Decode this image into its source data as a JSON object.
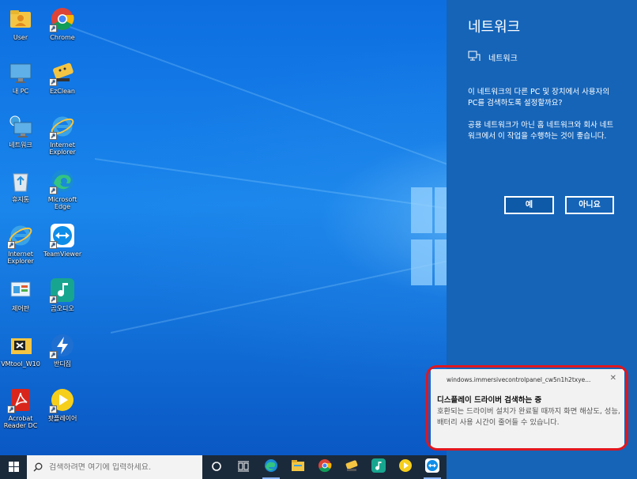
{
  "desktop": {
    "icons": [
      {
        "label": "User",
        "icon": "folder-user-icon"
      },
      {
        "label": "Chrome",
        "icon": "chrome-icon"
      },
      {
        "label": "내 PC",
        "icon": "monitor-icon"
      },
      {
        "label": "EzClean",
        "icon": "ezclean-icon"
      },
      {
        "label": "네트워크",
        "icon": "network-icon"
      },
      {
        "label": "Internet Explorer",
        "icon": "ie-icon"
      },
      {
        "label": "휴지통",
        "icon": "recycle-bin-icon"
      },
      {
        "label": "Microsoft Edge",
        "icon": "edge-icon"
      },
      {
        "label": "Internet Explorer",
        "icon": "ie-icon"
      },
      {
        "label": "TeamViewer",
        "icon": "teamviewer-icon"
      },
      {
        "label": "제어판",
        "icon": "control-panel-icon"
      },
      {
        "label": "곰오디오",
        "icon": "gom-audio-icon"
      },
      {
        "label": "VMtool_W10",
        "icon": "vmtool-icon"
      },
      {
        "label": "반디집",
        "icon": "bandizip-icon"
      },
      {
        "label": "Acrobat Reader DC",
        "icon": "acrobat-icon"
      },
      {
        "label": "팟플레이어",
        "icon": "potplayer-icon"
      }
    ]
  },
  "network_panel": {
    "title": "네트워크",
    "network_name": "네트워크",
    "question": "이 네트워크의 다른 PC 및 장치에서 사용자의 PC를 검색하도록 설정할까요?",
    "advice": "공용 네트워크가 아닌 홈 네트워크와 회사 네트워크에서 이 작업을 수행하는 것이 좋습니다.",
    "yes_label": "예",
    "no_label": "아니요"
  },
  "toast": {
    "app": "windows.immersivecontrolpanel_cw5n1h2txye...",
    "close": "✕",
    "title": "디스플레이 드라이버 검색하는 중",
    "body": "호환되는 드라이버 설치가 완료될 때까지 화면 해상도, 성능, 배터리 사용 시간이 줄어들 수 있습니다."
  },
  "taskbar": {
    "search_placeholder": "검색하려면 여기에 입력하세요.",
    "items": [
      "cortana-icon",
      "task-view-icon",
      "edge-icon",
      "file-explorer-icon",
      "chrome-icon",
      "ezclean-icon",
      "gom-audio-icon",
      "potplayer-icon",
      "teamviewer-icon"
    ]
  },
  "colors": {
    "panel_bg": "#1564b8",
    "taskbar_bg": "#1b2a3b",
    "highlight": "#e0161e"
  }
}
